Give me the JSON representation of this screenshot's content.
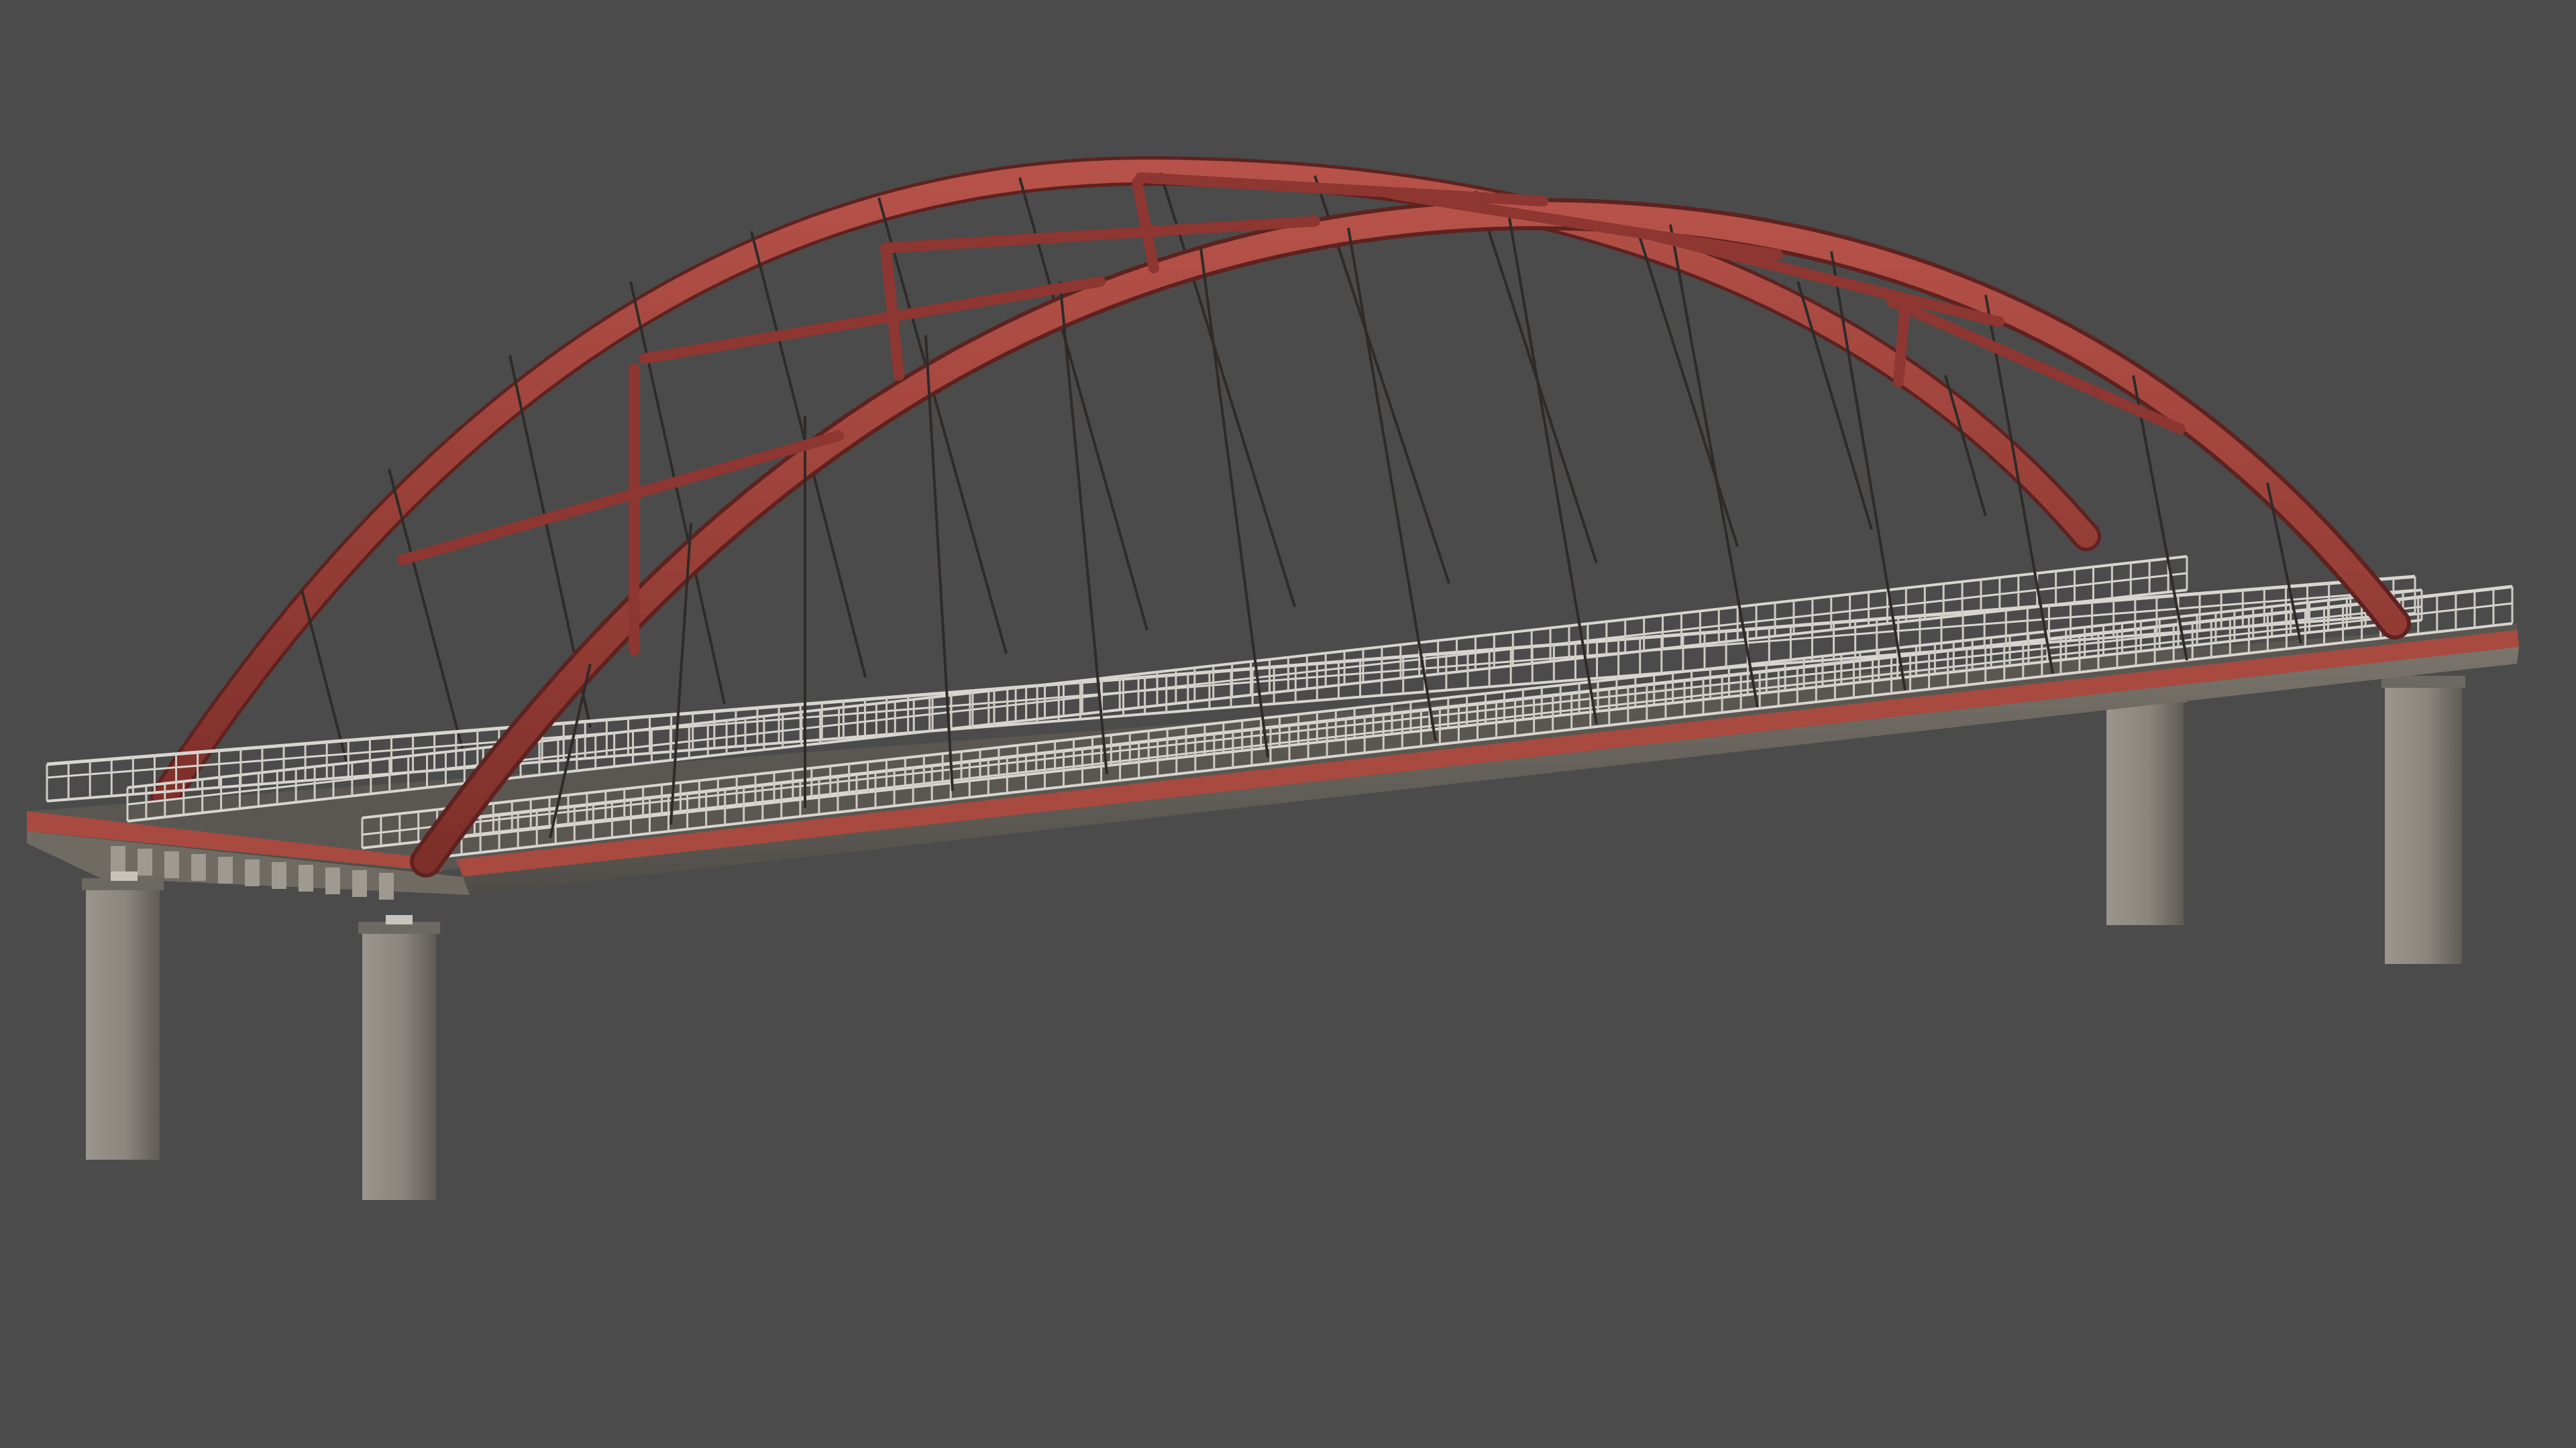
{
  "scene": {
    "subject": "bridge",
    "colors": {
      "background": "#4b4b4b",
      "arch": "#9e3d36",
      "arch_shadow": "#5a211e",
      "deck_edge": "#a84a3f",
      "deck_side": "#6f6a62",
      "pier": "#8c877f",
      "railing": "#d8d6d0",
      "cable": "#2e2b29"
    }
  }
}
